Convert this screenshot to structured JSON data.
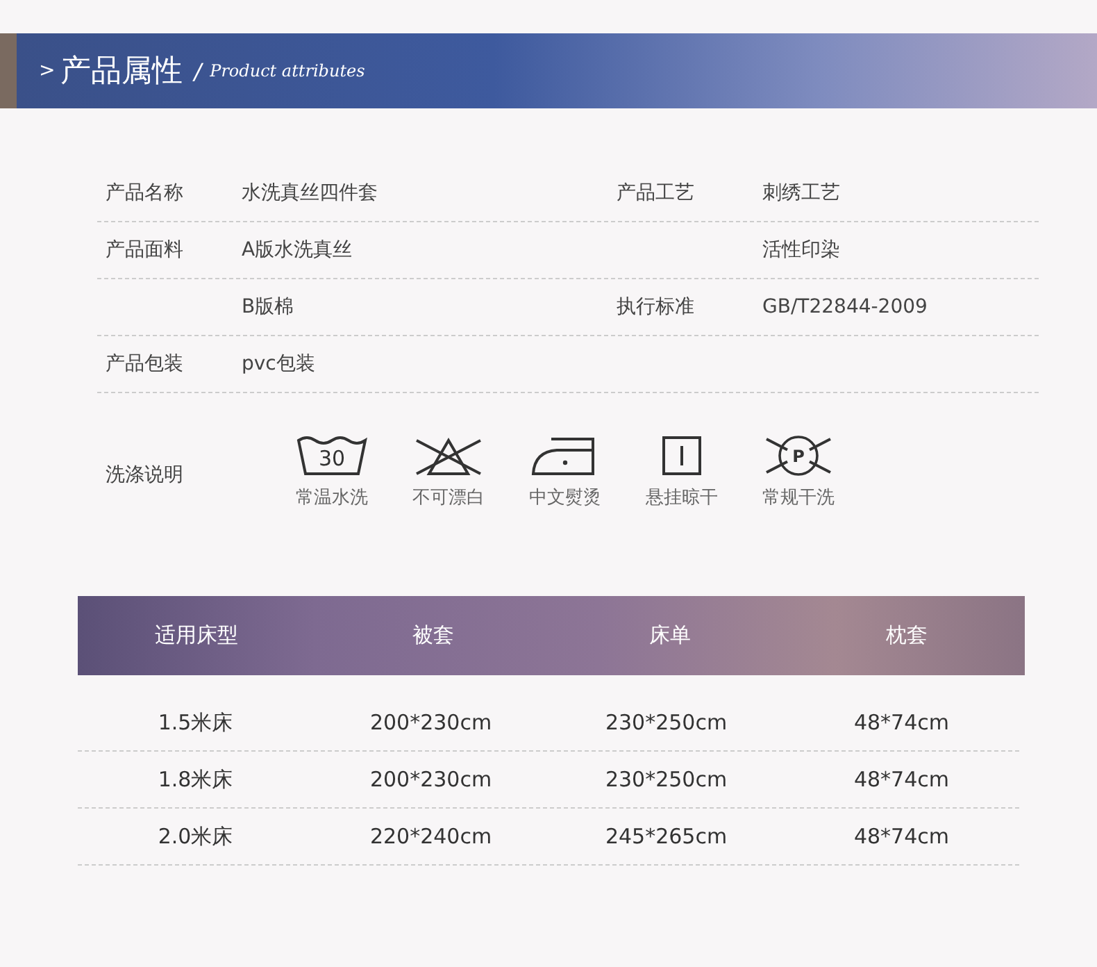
{
  "header": {
    "arrow": ">",
    "title": "产品属性",
    "separator": "/",
    "subtitle": "Product attributes"
  },
  "attributes": [
    {
      "label": "产品名称",
      "value": "水洗真丝四件套",
      "label_2": "产品工艺",
      "value_2": "刺绣工艺"
    },
    {
      "label": "产品面料",
      "value": "A版水洗真丝",
      "value_2": "活性印染"
    },
    {
      "value": "B版棉",
      "label_2": "执行标准",
      "value_2": "GB/T22844-2009"
    },
    {
      "label": "产品包装",
      "value": "pvc包装"
    }
  ],
  "care": {
    "label": "洗涤说明",
    "symbols": [
      {
        "kind": "wash",
        "mark": "30",
        "caption": "常温水洗"
      },
      {
        "kind": "no-bleach",
        "caption": "不可漂白"
      },
      {
        "kind": "iron",
        "caption": "中文熨烫"
      },
      {
        "kind": "hang-dry",
        "caption": "悬挂晾干"
      },
      {
        "kind": "no-dry-clean",
        "mark": "P",
        "caption": "常规干洗"
      }
    ]
  },
  "sizes": {
    "columns": [
      "适用床型",
      "被套",
      "床单",
      "枕套"
    ],
    "rows": [
      [
        "1.5米床",
        "200*230cm",
        "230*250cm",
        "48*74cm"
      ],
      [
        "1.8米床",
        "200*230cm",
        "230*250cm",
        "48*74cm"
      ],
      [
        "2.0米床",
        "220*240cm",
        "245*265cm",
        "48*74cm"
      ]
    ]
  }
}
